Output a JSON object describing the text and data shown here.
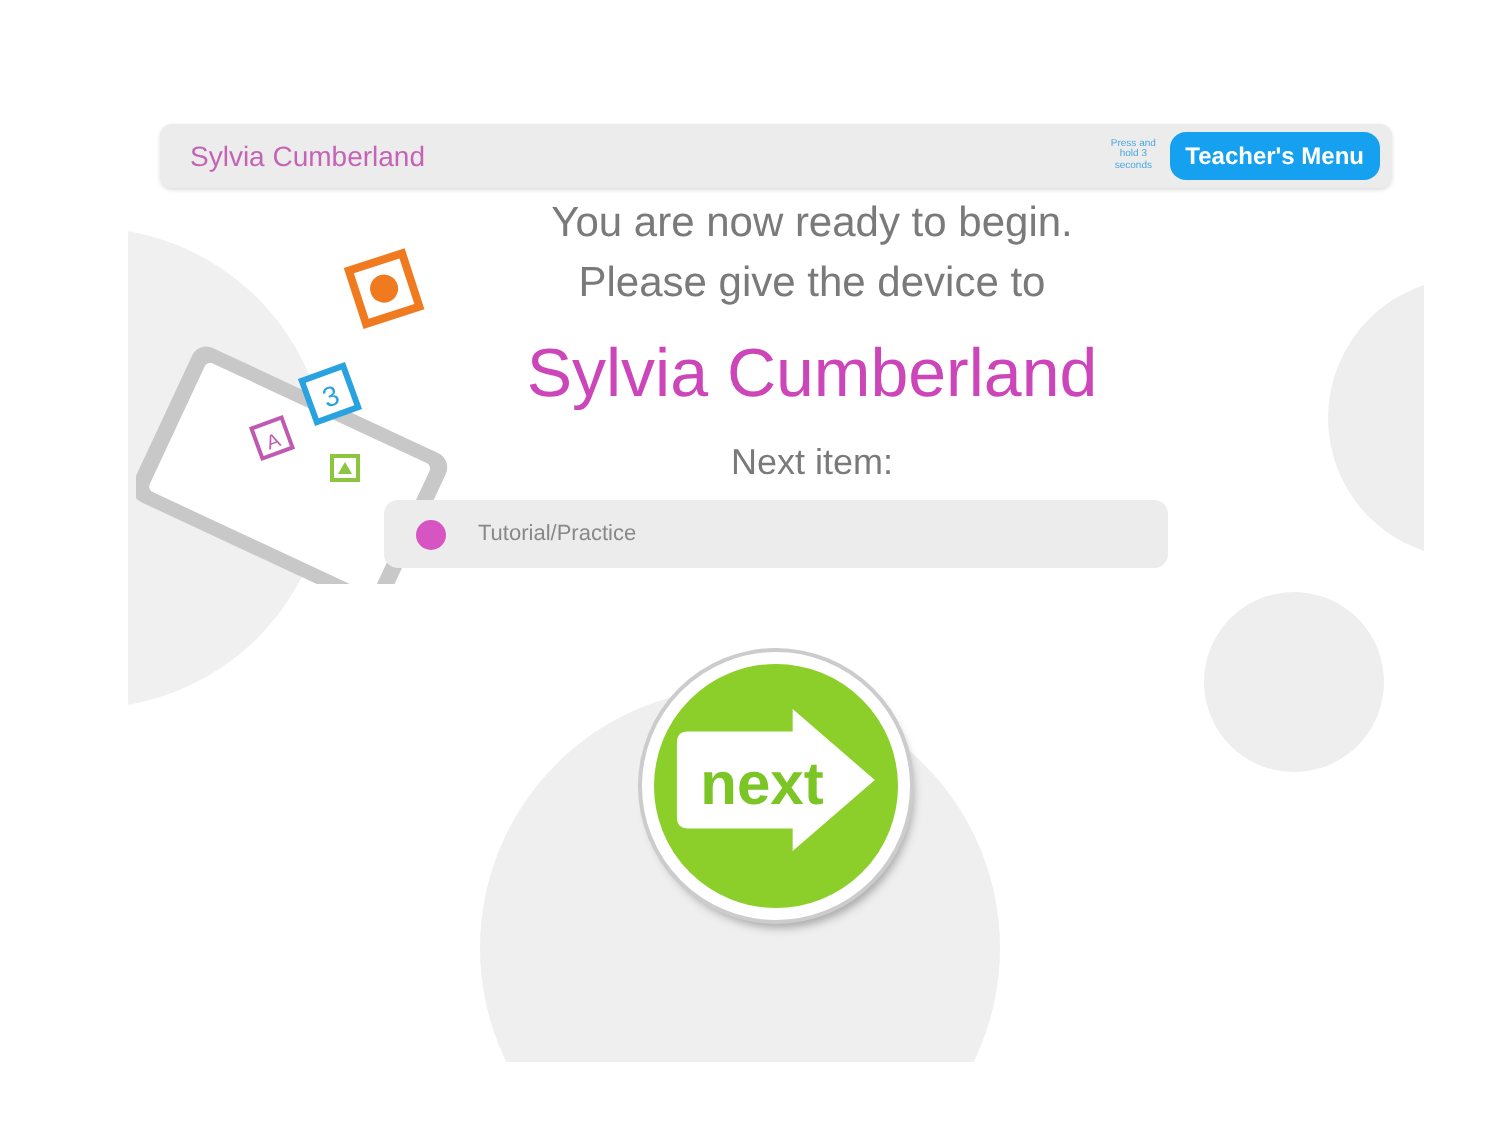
{
  "header": {
    "student_name": "Sylvia Cumberland",
    "hint": "Press and hold 3 seconds",
    "menu_button": "Teacher's Menu"
  },
  "message": {
    "line_1": "You are now ready to begin.",
    "line_2": "Please give the device to",
    "name": "Sylvia Cumberland"
  },
  "next_item": {
    "label": "Next item:",
    "item": "Tutorial/Practice"
  },
  "next_button": {
    "label": "next"
  },
  "illustration": {
    "card_labels": [
      "3",
      "A"
    ]
  }
}
